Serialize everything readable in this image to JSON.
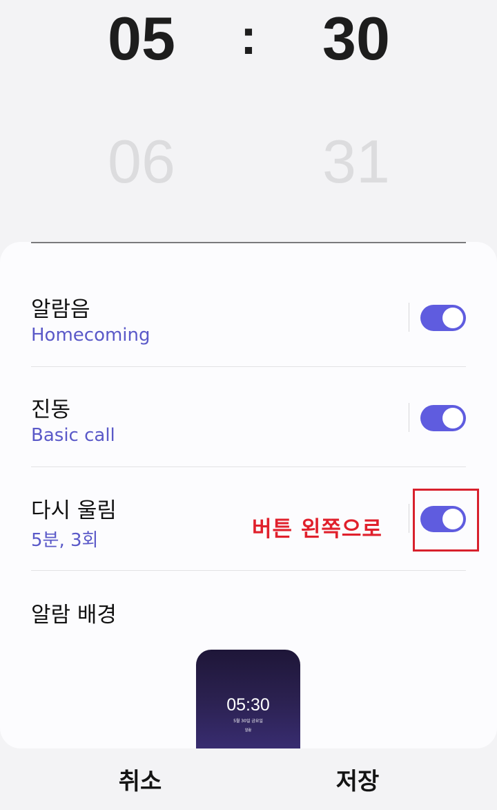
{
  "picker": {
    "hour_selected": "05",
    "hour_next": "06",
    "separator": ":",
    "minute_selected": "30",
    "minute_next": "31"
  },
  "settings": [
    {
      "title": "알람음",
      "subtitle": "Homecoming",
      "toggle_on": true
    },
    {
      "title": "진동",
      "subtitle": "Basic call",
      "toggle_on": true
    },
    {
      "title": "다시 울림",
      "subtitle": "5분, 3회",
      "toggle_on": true
    }
  ],
  "annotation": {
    "text": "버튼 왼쪽으로",
    "color": "#e0202c"
  },
  "background_section": {
    "title": "알람 배경",
    "preview": {
      "time": "05:30",
      "date": "5월 30일 금요일",
      "label": "알람"
    }
  },
  "bottom": {
    "cancel_label": "취소",
    "save_label": "저장"
  },
  "colors": {
    "accent": "#5f5cdf",
    "subtitle": "#5a59c8",
    "page_bg": "#f3f3f5",
    "card_bg": "#fcfcfe"
  }
}
